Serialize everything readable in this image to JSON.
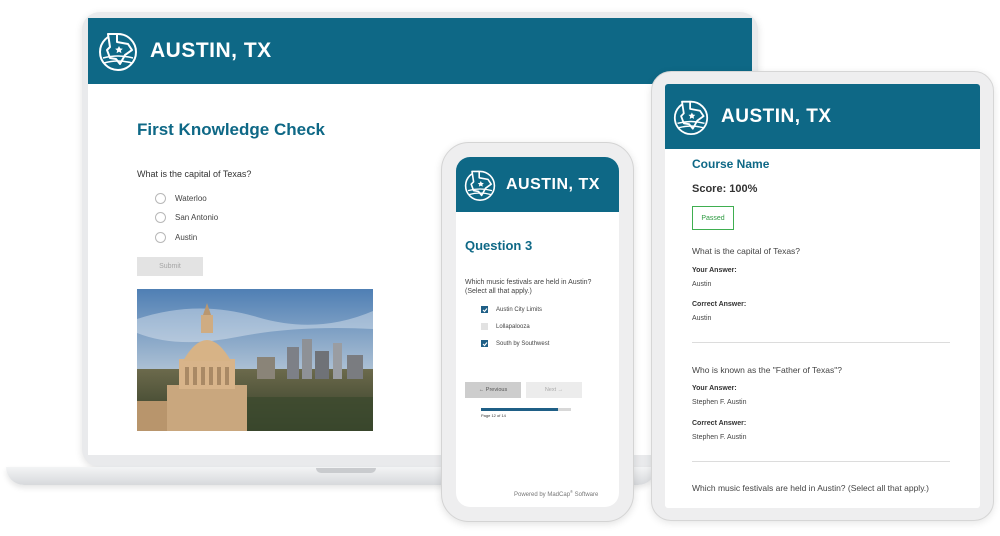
{
  "brand": {
    "name": "AUSTIN, TX",
    "color": "#0e6886",
    "logo_icon": "texas-map-logo-icon"
  },
  "laptop": {
    "heading": "First Knowledge Check",
    "question": "What is the capital of Texas?",
    "options": [
      "Waterloo",
      "San Antonio",
      "Austin"
    ],
    "submit_label": "Submit",
    "photo_icon": "texas-capitol-photo"
  },
  "phone": {
    "heading": "Question 3",
    "question": "Which music festivals are held in Austin? (Select all that apply.)",
    "options": [
      {
        "label": "Austin City Limits",
        "checked": true
      },
      {
        "label": "Lollapalooza",
        "checked": false
      },
      {
        "label": "South by Southwest",
        "checked": true
      }
    ],
    "prev_label": "← Previous",
    "next_label": "Next →",
    "progress": 0.857,
    "page_indicator": "Page 12 of 14",
    "powered_prefix": "Powered by MadCap",
    "powered_mark": "®",
    "powered_suffix": " Software"
  },
  "tablet": {
    "course_name": "Course Name",
    "score": "Score: 100%",
    "status": "Passed",
    "your_answer_label": "Your Answer:",
    "correct_answer_label": "Correct Answer:",
    "questions": [
      {
        "question": "What is the capital of Texas?",
        "your_answer": "Austin",
        "correct_answer": "Austin"
      },
      {
        "question": "Who is known as the \"Father of Texas\"?",
        "your_answer": "Stephen F. Austin",
        "correct_answer": "Stephen F. Austin"
      },
      {
        "question": "Which music festivals are held in Austin? (Select all that apply.)"
      }
    ]
  }
}
